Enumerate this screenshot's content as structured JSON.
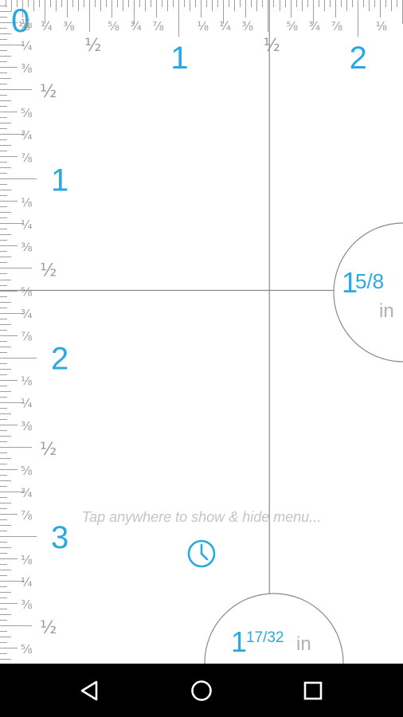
{
  "ruler": {
    "unit": "in",
    "zero_label": "0",
    "top_inch_labels": [
      "1",
      "2"
    ],
    "left_inch_labels": [
      "1",
      "2",
      "3"
    ],
    "fraction_labels": [
      "⅛",
      "¼",
      "⅜",
      "½",
      "⅝",
      "¾",
      "⅞"
    ],
    "ticks_per_inch": 32,
    "crosshair": {
      "vertical_in": 1.5078125,
      "horizontal_in": 1.625
    },
    "horizontal_reading": {
      "whole": "1",
      "fraction": "5/8",
      "unit": "in"
    },
    "vertical_reading": {
      "whole": "1",
      "fraction": "17/32",
      "unit": "in"
    }
  },
  "hint": {
    "text": "Tap anywhere to show & hide menu..."
  },
  "icons": {
    "history": "clock-icon",
    "back": "back-triangle-icon",
    "home": "home-circle-icon",
    "recents": "recents-square-icon"
  },
  "colors": {
    "accent": "#29a9e1",
    "tick": "#9e9e9e",
    "navbar": "#000000"
  }
}
